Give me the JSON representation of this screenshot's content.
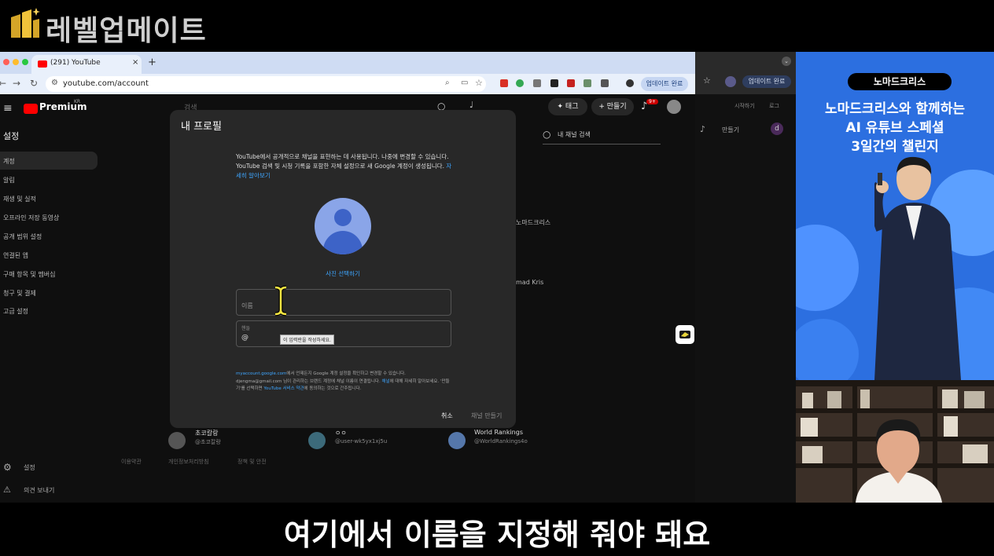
{
  "brand": {
    "name": "레벨업메이트"
  },
  "browser": {
    "tab_title": "(291) YouTube",
    "tab_close": "×",
    "new_tab": "+",
    "url": "youtube.com/account",
    "update_button": "업데이트 완료",
    "update_button_2": "업데이트 완료"
  },
  "youtube": {
    "menu": "≡",
    "premium_label": "Premium",
    "region": "KR",
    "search_placeholder": "검색",
    "tag_button": "✦ 태그",
    "create_button": "+ 만들기",
    "notifications_badge": "9+",
    "settings_title": "설정",
    "sidebar_items": [
      "계정",
      "알림",
      "재생 및 실적",
      "오프라인 저장 동영상",
      "공개 범위 설정",
      "연결된 앱",
      "구매 항목 및 멤버십",
      "청구 및 결제",
      "고급 설정"
    ],
    "sidebar_bottom_settings": "설정",
    "sidebar_bottom_feedback": "의견 보내기",
    "channel_search": "내 채널 검색",
    "background_channels": [
      {
        "name": "초코칼랑",
        "handle": "@초코칼랑"
      },
      {
        "name": "ㅇㅇ",
        "handle": "@user-wk5yx1xj5u"
      },
      {
        "name": "World Rankings",
        "handle": "@WorldRankings4o"
      }
    ],
    "background_fragments": [
      "노마드크리스",
      "mad Kris"
    ],
    "footer_links": [
      "이용약관",
      "개인정보처리방침",
      "정책 및 안전"
    ],
    "second_window": {
      "start": "시작하기",
      "log": "로그",
      "create": "만들기",
      "avatar_letter": "d"
    }
  },
  "dialog": {
    "title": "내 프로필",
    "description": "YouTube에서 공개적으로 채널을 표현하는 데 사용됩니다. 나중에 변경할 수 있습니다. YouTube 검색 및 시청 기록을 포함한 자체 설정으로 새 Google 계정이 생성됩니다.",
    "learn_more": "자세히 알아보기",
    "choose_photo": "사진 선택하기",
    "name_placeholder": "이름",
    "handle_label": "핸들",
    "handle_prefix": "@",
    "tooltip": "이 입력란을 작성하세요.",
    "terms_link_1": "myaccount.google.com",
    "terms_text_1": "에서 언제든지 Google 계정 설정을 확인하고 변경할 수 있습니다. djengma@gmail.com 님이 관리하는 브랜드 계정에 채널 이름이 연결됩니다.",
    "terms_link_2": "채널",
    "terms_text_2": "에 대해 자세히 알아보세요. '만들기'를 선택하면",
    "terms_link_3": "YouTube 서비스 약관",
    "terms_text_3": "에 동의하는 것으로 간주됩니다.",
    "cancel": "취소",
    "create_channel": "채널 만들기"
  },
  "ad": {
    "tag": "노마드크리스",
    "line1": "노마드크리스와 함께하는",
    "line2": "AI 유튜브 스페셜",
    "line3": "3일간의 챌린지"
  },
  "subtitle": "여기에서 이름을 지정해 줘야 돼요",
  "colors": {
    "accent": "#3ea6ff",
    "youtube_red": "#ff0000",
    "ad_blue": "#2c6fe0"
  }
}
